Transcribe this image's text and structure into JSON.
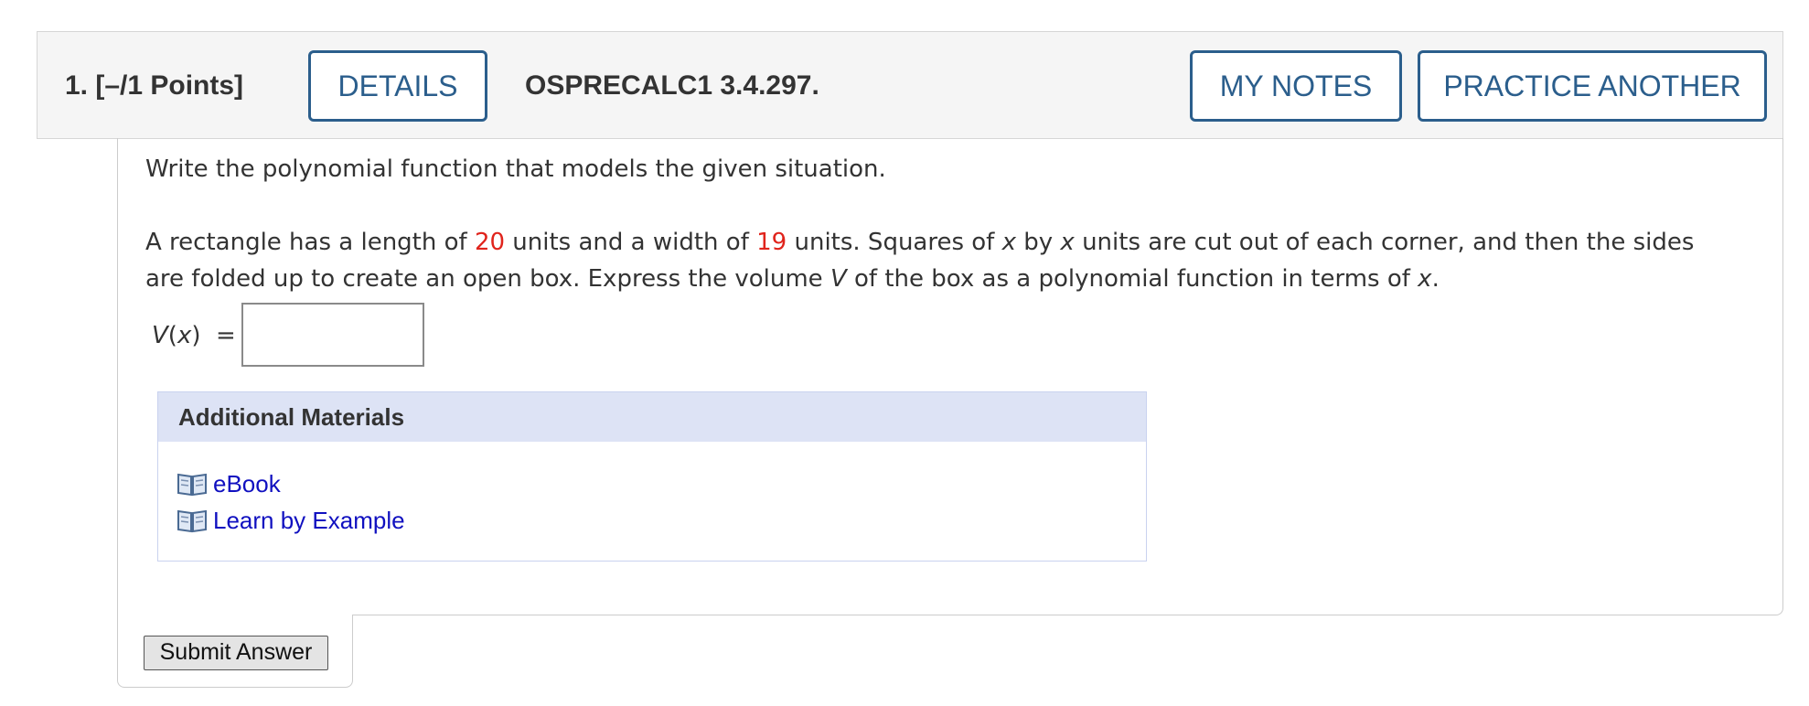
{
  "question": {
    "number_points": "1.  [–/1 Points]",
    "details_label": "DETAILS",
    "code": "OSPRECALC1 3.4.297.",
    "my_notes_label": "MY NOTES",
    "practice_label": "PRACTICE ANOTHER"
  },
  "body": {
    "intro": "Write the polynomial function that models the given situation.",
    "problem": {
      "p1": "A rectangle has a length of ",
      "length": "20",
      "p2": " units and a width of ",
      "width": "19",
      "p3": " units. Squares of ",
      "var1": "x",
      "p4": " by ",
      "var2": "x",
      "p5": " units are cut out of each corner, and then the sides are folded up to create an open box. Express the volume ",
      "vol": "V",
      "p6": " of the box as a polynomial function in terms of ",
      "var3": "x",
      "p7": "."
    },
    "answer_label_v": "V",
    "answer_label_x": "x",
    "answer_value": ""
  },
  "materials": {
    "heading": "Additional Materials",
    "items": [
      {
        "label": "eBook",
        "icon": "book-icon"
      },
      {
        "label": "Learn by Example",
        "icon": "book-icon"
      }
    ]
  },
  "submit_label": "Submit Answer",
  "colors": {
    "accent": "#2b5e8c",
    "highlight": "#e0241c",
    "link": "#1010c0",
    "materials_header": "#dde3f5"
  }
}
